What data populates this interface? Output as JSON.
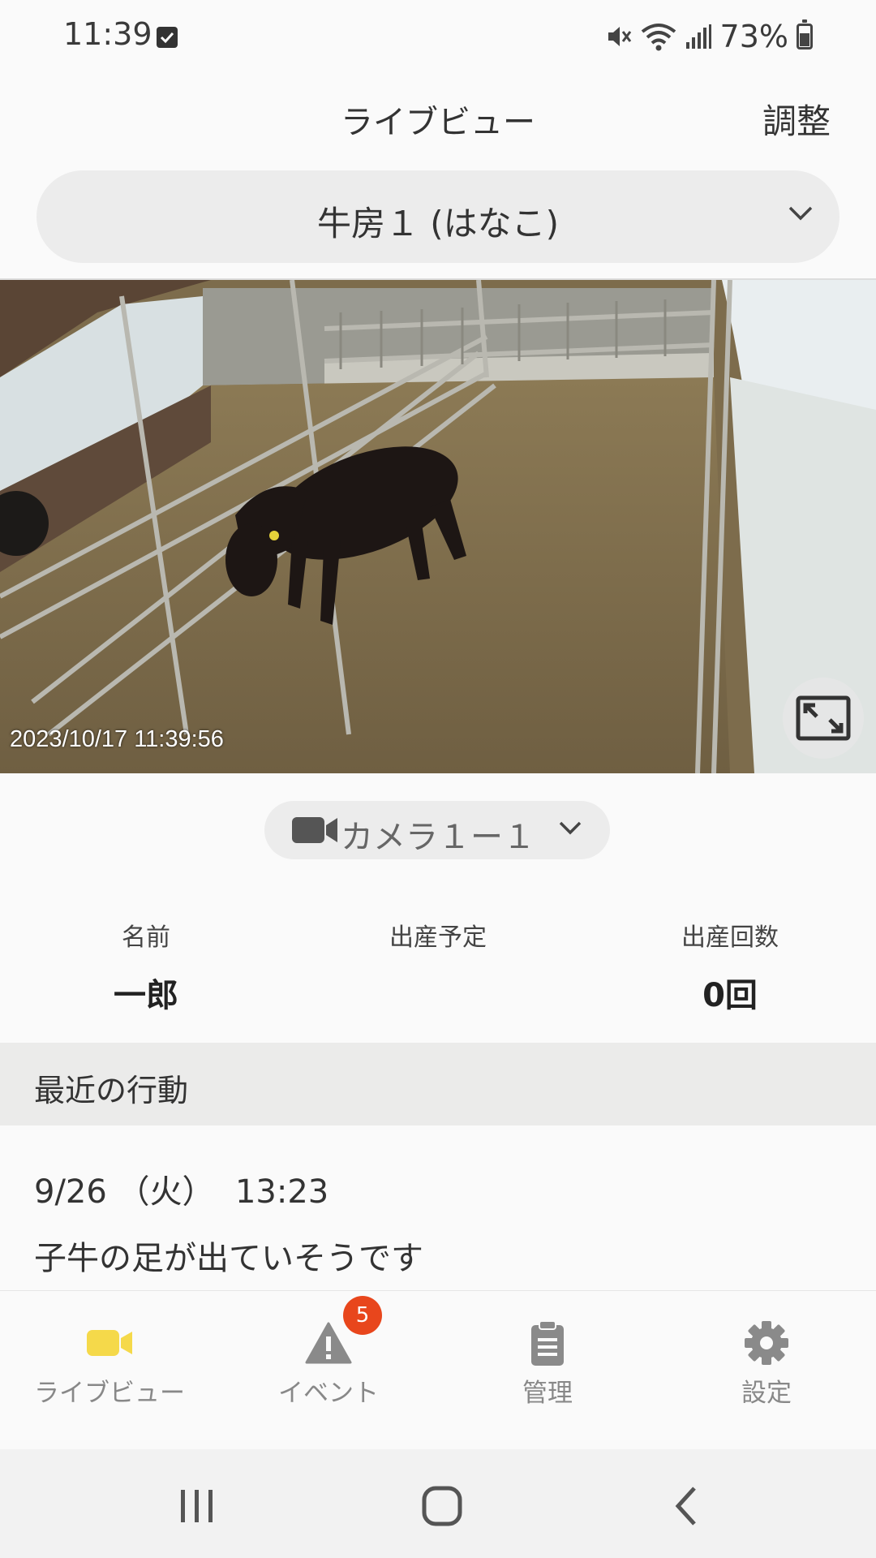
{
  "status_bar": {
    "time": "11:39",
    "battery_text": "73%",
    "icons": [
      "checkbox-notification-icon",
      "mute-icon",
      "wifi-icon",
      "signal-icon",
      "battery-icon"
    ]
  },
  "header": {
    "title": "ライブビュー",
    "adjust_label": "調整"
  },
  "pen_select": {
    "label": "牛房１ (はなこ)"
  },
  "camera": {
    "timestamp": "2023/10/17  11:39:56",
    "select_label": "カメラ１ー１"
  },
  "info": {
    "name_label": "名前",
    "name_value": "一郎",
    "due_label": "出産予定",
    "due_value": "",
    "count_label": "出産回数",
    "count_value": "0回"
  },
  "recent": {
    "title": "最近の行動",
    "items": [
      {
        "datetime": "9/26 （火）  13:23",
        "description": "子牛の足が出ていそうです"
      }
    ]
  },
  "bottom_nav": {
    "items": [
      {
        "label": "ライブビュー",
        "icon": "video-camera-icon",
        "active": true
      },
      {
        "label": "イベント",
        "icon": "warning-icon",
        "badge": "5"
      },
      {
        "label": "管理",
        "icon": "clipboard-icon"
      },
      {
        "label": "設定",
        "icon": "gear-icon"
      }
    ]
  },
  "colors": {
    "accent_yellow": "#f5d94a",
    "badge_red": "#e8461c",
    "inactive_gray": "#888888"
  }
}
